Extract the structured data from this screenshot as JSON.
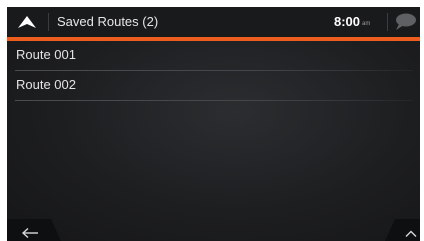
{
  "header": {
    "title": "Saved Routes (2)",
    "time": "8:00",
    "ampm": "am"
  },
  "routes": [
    {
      "label": "Route 001"
    },
    {
      "label": "Route 002"
    }
  ],
  "icons": {
    "up": "up-arrow-icon",
    "message": "speech-bubble-icon",
    "back": "back-arrow-icon",
    "menu": "chevron-up-icon"
  },
  "colors": {
    "accent": "#ec5d1e",
    "background": "#1d1e20",
    "text": "#e3e3e3"
  }
}
